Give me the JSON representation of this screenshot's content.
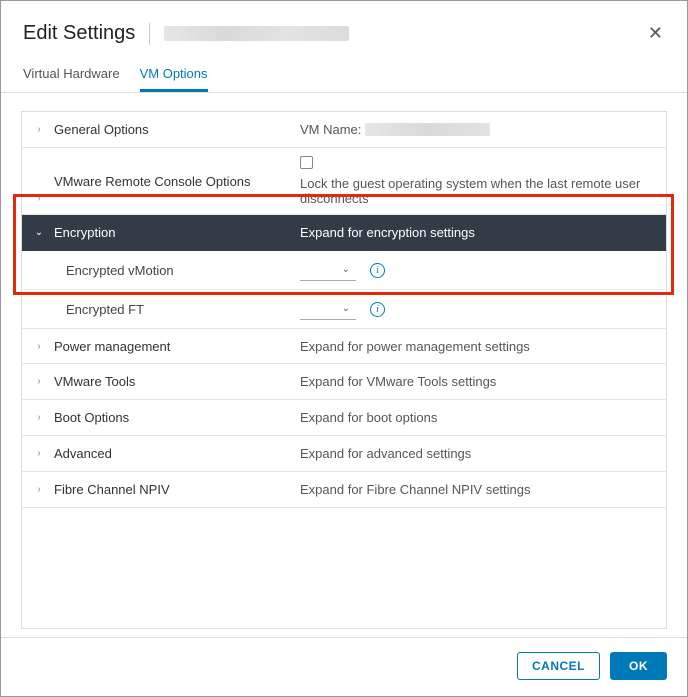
{
  "header": {
    "title": "Edit Settings"
  },
  "tabs": {
    "hardware": "Virtual Hardware",
    "vmoptions": "VM Options"
  },
  "sections": {
    "general": {
      "label": "General Options",
      "right_prefix": "VM Name: "
    },
    "remote": {
      "label": "VMware Remote Console Options",
      "desc": "Lock the guest operating system when the last remote user disconnects"
    },
    "encryption": {
      "label": "Encryption",
      "desc": "Expand for encryption settings"
    },
    "enc_vmotion": {
      "label": "Encrypted vMotion"
    },
    "enc_ft": {
      "label": "Encrypted FT"
    },
    "power": {
      "label": "Power management",
      "desc": "Expand for power management settings"
    },
    "vmtools": {
      "label": "VMware Tools",
      "desc": "Expand for VMware Tools settings"
    },
    "boot": {
      "label": "Boot Options",
      "desc": "Expand for boot options"
    },
    "advanced": {
      "label": "Advanced",
      "desc": "Expand for advanced settings"
    },
    "npiv": {
      "label": "Fibre Channel NPIV",
      "desc": "Expand for Fibre Channel NPIV settings"
    }
  },
  "footer": {
    "cancel": "CANCEL",
    "ok": "OK"
  }
}
